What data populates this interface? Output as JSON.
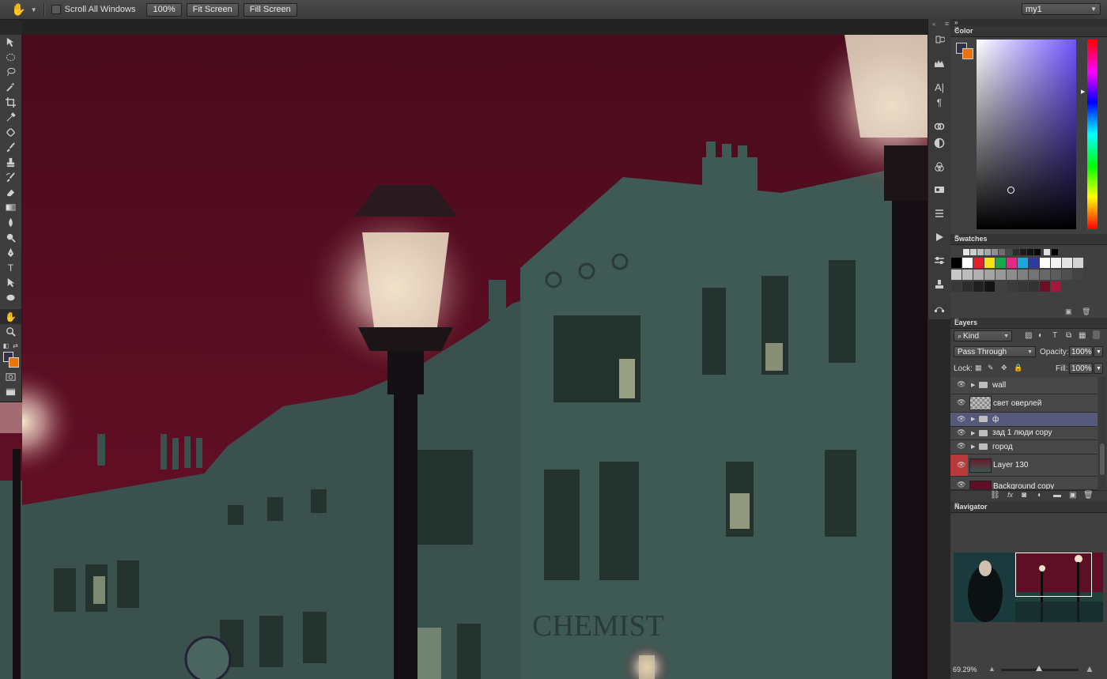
{
  "options_bar": {
    "scroll_all_windows_label": "Scroll All Windows",
    "btn_100": "100%",
    "btn_fit": "Fit Screen",
    "btn_fill": "Fill Screen",
    "workspace": "my1"
  },
  "colors": {
    "foreground": "#323149",
    "background": "#e9730c",
    "sky": "#5e0f25",
    "building": "#3d5852"
  },
  "canvas": {
    "sign_text": "CHEMIST"
  },
  "panels": {
    "color_title": "Color",
    "swatches_title": "Swatches",
    "layers_title": "Layers",
    "navigator_title": "Navigator"
  },
  "layers": {
    "filter_kind": "Kind",
    "blend_mode": "Pass Through",
    "opacity_label": "Opacity:",
    "opacity_value": "100%",
    "lock_label": "Lock:",
    "fill_label": "Fill:",
    "fill_value": "100%",
    "items": [
      {
        "name": "wall"
      },
      {
        "name": "свет оверлей"
      },
      {
        "name": "ф"
      },
      {
        "name": "зад 1 люди copy"
      },
      {
        "name": "город"
      },
      {
        "name": "Layer 130"
      },
      {
        "name": "Background copy"
      }
    ]
  },
  "navigator": {
    "zoom": "69.29%"
  }
}
